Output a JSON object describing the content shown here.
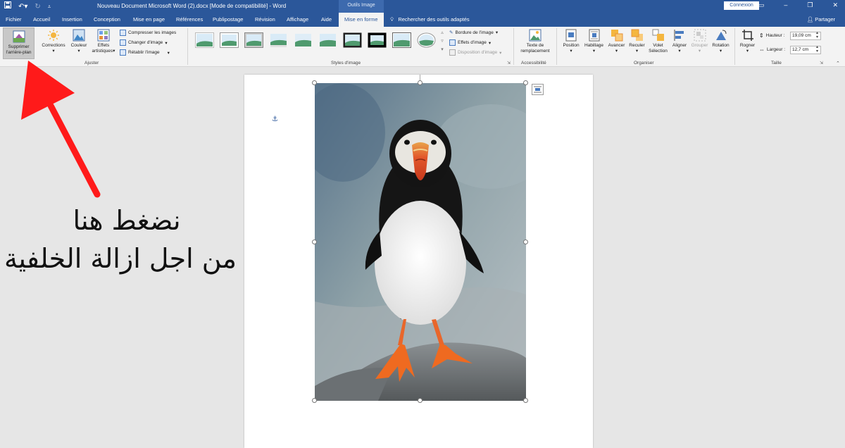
{
  "window": {
    "title": "Nouveau Document Microsoft Word (2).docx [Mode de compatibilité]  -  Word",
    "context_tab": "Outils Image",
    "signin": "Connexion",
    "share": "Partager"
  },
  "tabs": [
    {
      "label": "Fichier"
    },
    {
      "label": "Accueil"
    },
    {
      "label": "Insertion"
    },
    {
      "label": "Conception"
    },
    {
      "label": "Mise en page"
    },
    {
      "label": "Références"
    },
    {
      "label": "Publipostage"
    },
    {
      "label": "Révision"
    },
    {
      "label": "Affichage"
    },
    {
      "label": "Aide"
    },
    {
      "label": "Mise en forme"
    }
  ],
  "tell_me": "Rechercher des outils adaptés",
  "ribbon": {
    "ajuster": {
      "label": "Ajuster",
      "remove_bg_line1": "Supprimer",
      "remove_bg_line2": "l'arrière-plan",
      "corrections": "Corrections",
      "couleur": "Couleur",
      "effets_line1": "Effets",
      "effets_line2": "artistiques",
      "compresser": "Compresser les images",
      "changer": "Changer d'image",
      "retablir": "Rétablir l'image"
    },
    "styles": {
      "label": "Styles d'image",
      "bordure": "Bordure de l'image",
      "effets": "Effets d'image",
      "disposition": "Disposition d'image"
    },
    "accessibilite": {
      "label": "Accessibilité",
      "alt_line1": "Texte de",
      "alt_line2": "remplacement"
    },
    "organiser": {
      "label": "Organiser",
      "position": "Position",
      "habillage": "Habillage",
      "avancer": "Avancer",
      "reculer": "Reculer",
      "volet_line1": "Volet",
      "volet_line2": "Sélection",
      "aligner": "Aligner",
      "grouper": "Grouper",
      "rotation": "Rotation"
    },
    "taille": {
      "label": "Taille",
      "rogner": "Rogner",
      "hauteur_label": "Hauteur :",
      "hauteur_value": "19,09 cm",
      "largeur_label": "Largeur :",
      "largeur_value": "12,7 cm"
    }
  },
  "annotation": {
    "line1": "نضغط هنا",
    "line2": "من اجل ازالة الخلفية"
  },
  "colors": {
    "word_blue": "#2b579a",
    "arrow_red": "#ff1a1a"
  }
}
